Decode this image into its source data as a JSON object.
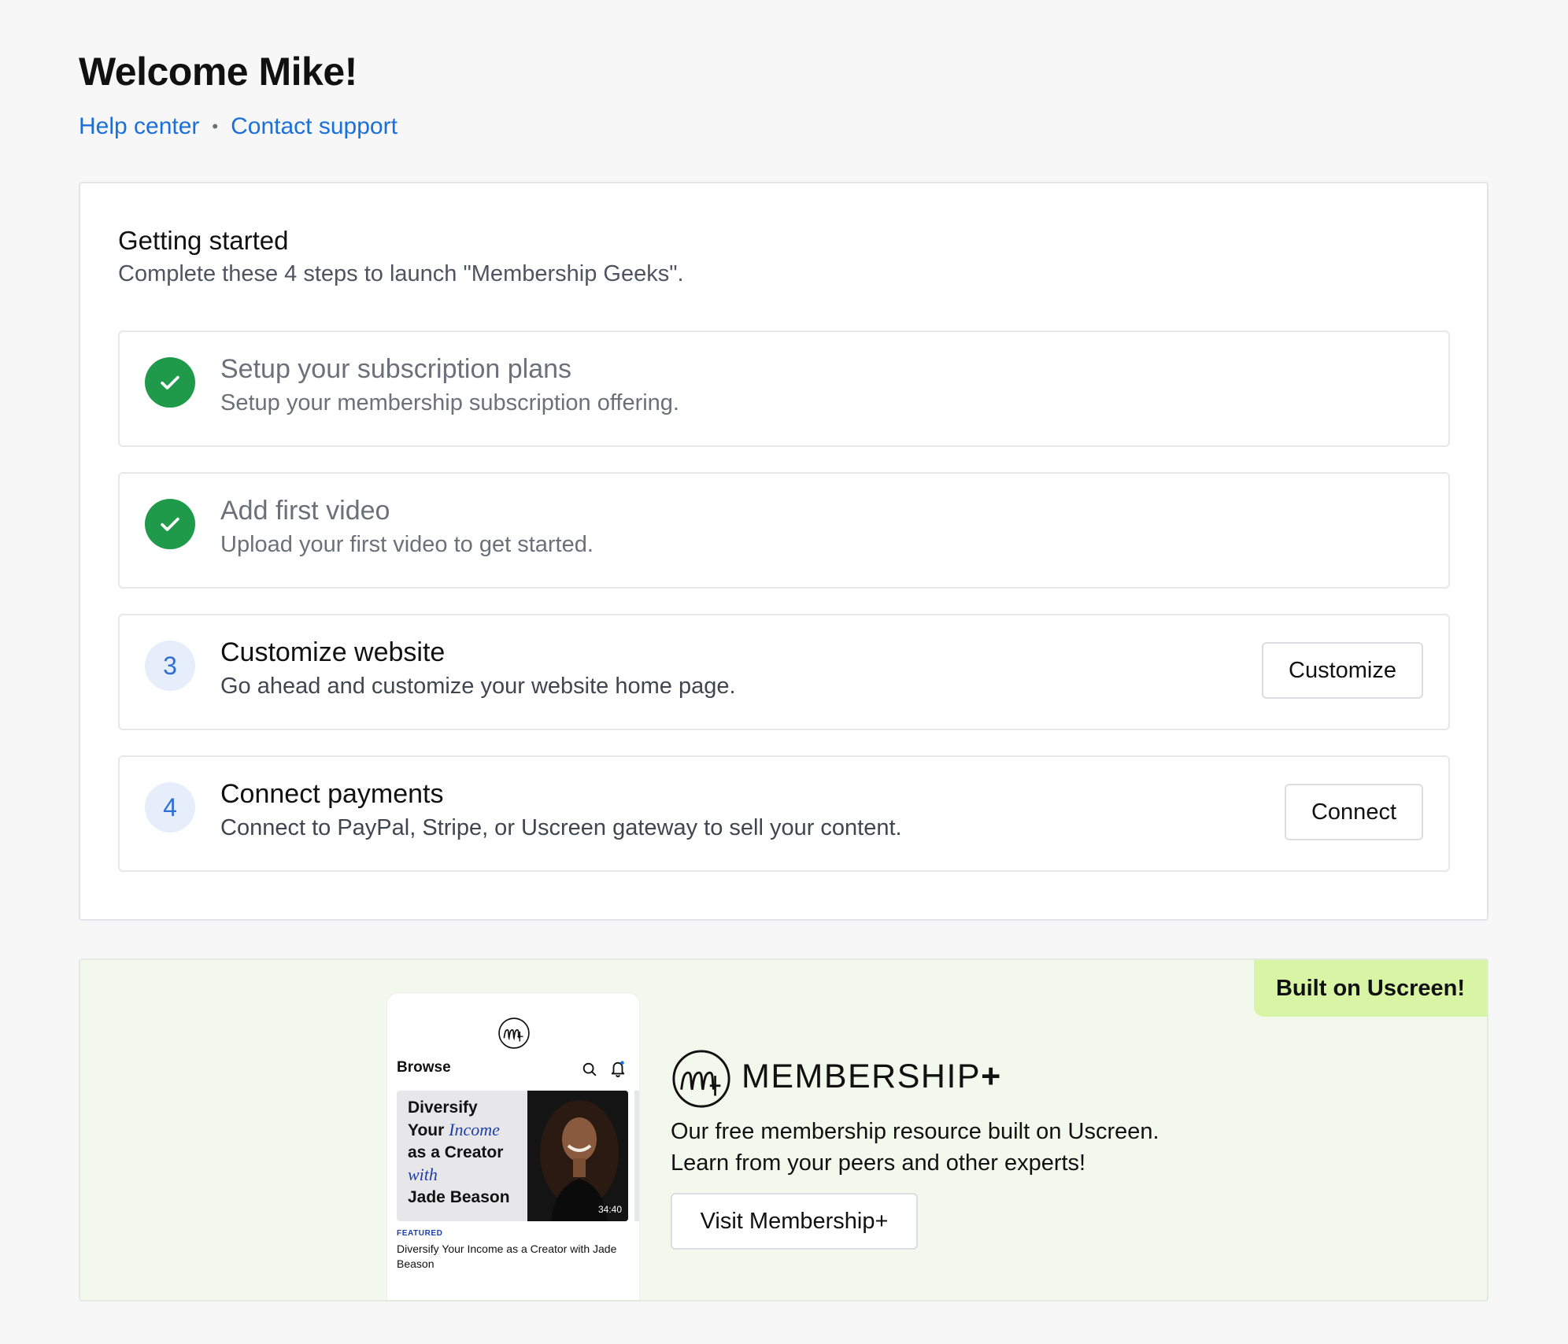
{
  "header": {
    "title": "Welcome Mike!",
    "links": [
      {
        "label": "Help center"
      },
      {
        "label": "Contact support"
      }
    ],
    "separator": "•"
  },
  "getting_started": {
    "title": "Getting started",
    "subtitle": "Complete these 4 steps to launch \"Membership Geeks\".",
    "steps": [
      {
        "number": "1",
        "status": "completed",
        "title": "Setup your subscription plans",
        "description": "Setup your membership subscription offering.",
        "button": ""
      },
      {
        "number": "2",
        "status": "completed",
        "title": "Add first video",
        "description": "Upload your first video to get started.",
        "button": ""
      },
      {
        "number": "3",
        "status": "pending",
        "title": "Customize website",
        "description": "Go ahead and customize your website home page.",
        "button": "Customize"
      },
      {
        "number": "4",
        "status": "pending",
        "title": "Connect payments",
        "description": "Connect to PayPal, Stripe, or Uscreen gateway to sell your content.",
        "button": "Connect"
      }
    ]
  },
  "promo": {
    "badge": "Built on Uscreen!",
    "brand_name": "MEMBERSHIP",
    "brand_plus": "+",
    "line1": "Our free membership resource built on Uscreen.",
    "line2": "Learn from your peers and other experts!",
    "button": "Visit Membership+",
    "phone": {
      "section": "Browse",
      "thumb_line1": "Diversify",
      "thumb_line2a": "Your ",
      "thumb_line2b": "Income",
      "thumb_line3": "as a Creator",
      "thumb_line4": "with",
      "thumb_line5": "Jade Beason",
      "duration": "34:40",
      "featured_label": "FEATURED",
      "featured_title": "Diversify Your Income as a Creator with Jade Beason"
    }
  },
  "colors": {
    "link": "#1a6fd9",
    "success": "#1f9a4a",
    "step_number_bg": "#e6eefb",
    "badge_bg": "#d8f5a6",
    "promo_bg": "#f3f8ec"
  }
}
